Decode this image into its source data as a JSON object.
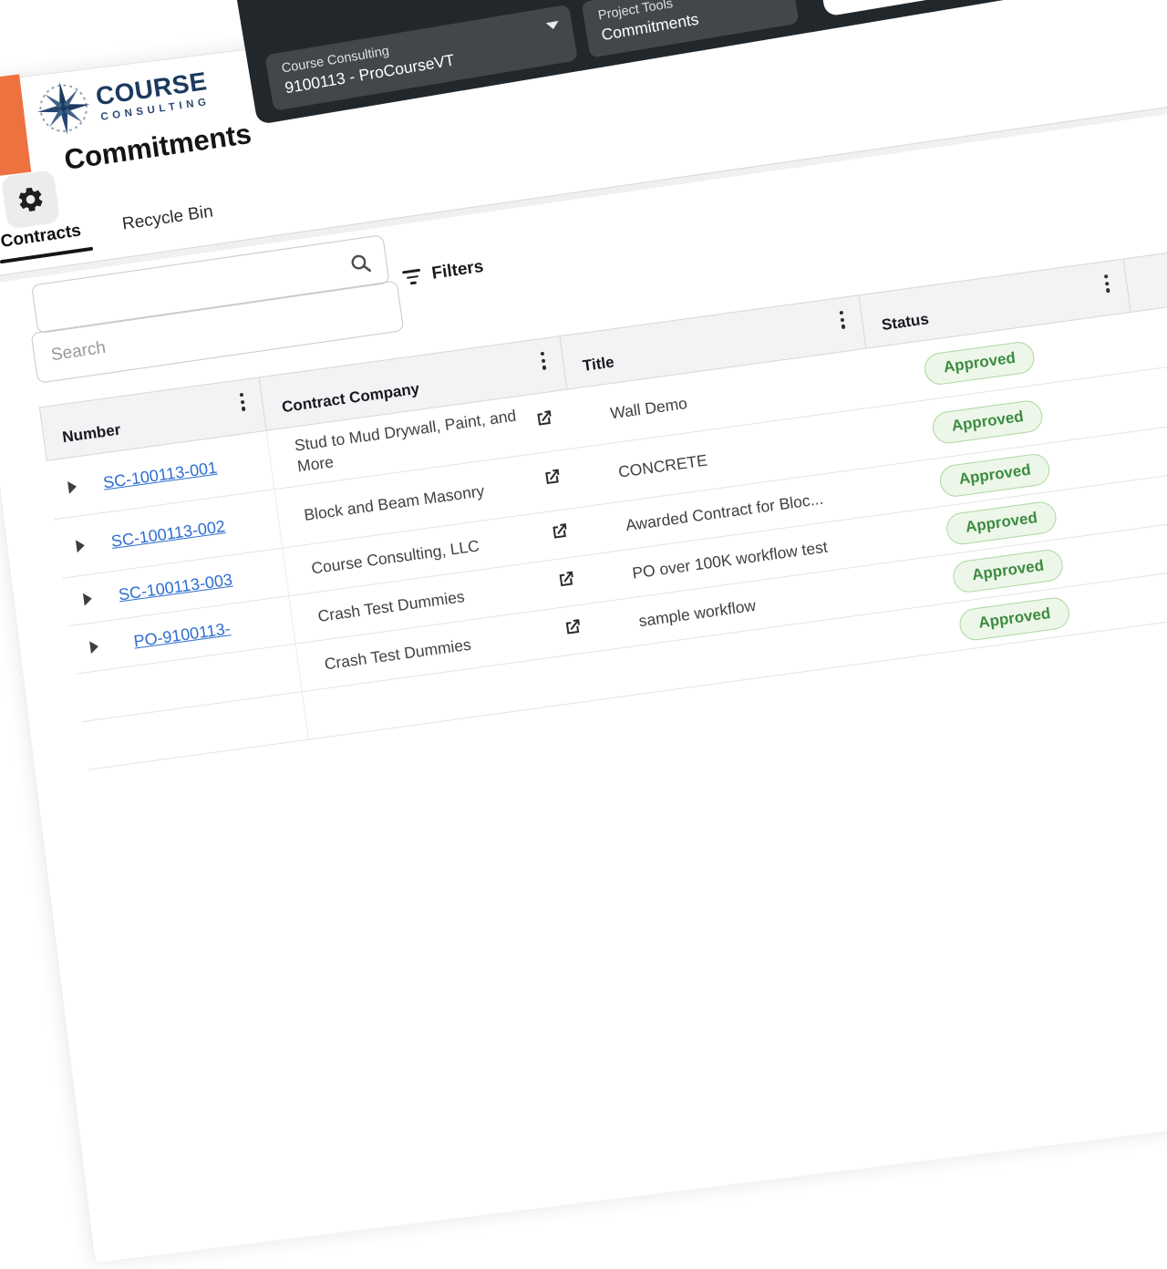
{
  "colors": {
    "accent_orange": "#EE7140",
    "navbar_bg": "#22272C",
    "navbar_box_bg": "#42474C",
    "logo_navy": "#1C3A5F",
    "link_blue": "#2E6ED0",
    "badge_bg": "#EDF7E9",
    "badge_border": "#A9D8A0",
    "badge_text": "#3D8B41"
  },
  "navbar": {
    "company_selector": {
      "line1": "Course Consulting",
      "line2": "9100113 - ProCourseVT"
    },
    "tool_selector": {
      "line1": "Project Tools",
      "line2": "Commitments"
    }
  },
  "logo": {
    "line1": "COURSE",
    "line2": "CONSULTING"
  },
  "page": {
    "title": "Commitments"
  },
  "tabs": [
    {
      "label": "Contracts",
      "active": true
    },
    {
      "label": "Recycle Bin",
      "active": false
    }
  ],
  "toolbar": {
    "search_placeholder": "Search",
    "filters_label": "Filters"
  },
  "table": {
    "columns": [
      {
        "label": "Number",
        "kebab": true
      },
      {
        "label": "Contract Company",
        "kebab": true
      },
      {
        "label": "Title",
        "kebab": true
      },
      {
        "label": "Status",
        "kebab": true
      },
      {
        "label": "",
        "kebab": false
      }
    ],
    "rows": [
      {
        "number": "SC-100113-001",
        "company": "Stud to Mud Drywall, Paint, and More",
        "title": "Wall Demo",
        "status": "Approved",
        "wrap": true
      },
      {
        "number": "SC-100113-002",
        "company": "Block and Beam Masonry",
        "title": "CONCRETE",
        "status": "Approved",
        "wrap": true
      },
      {
        "number": "SC-100113-003",
        "company": "Course Consulting, LLC",
        "title": "Awarded Contract for Bloc...",
        "status": "Approved",
        "wrap": false
      },
      {
        "number": "PO-9100113-",
        "company": "Crash Test Dummies",
        "title": "PO over 100K workflow test",
        "status": "Approved",
        "wrap": false
      },
      {
        "number": "",
        "company": "Crash Test Dummies",
        "title": "sample workflow",
        "status": "Approved",
        "wrap": false
      },
      {
        "number": "",
        "company": "",
        "title": "",
        "status": "Approved",
        "wrap": false
      }
    ]
  }
}
